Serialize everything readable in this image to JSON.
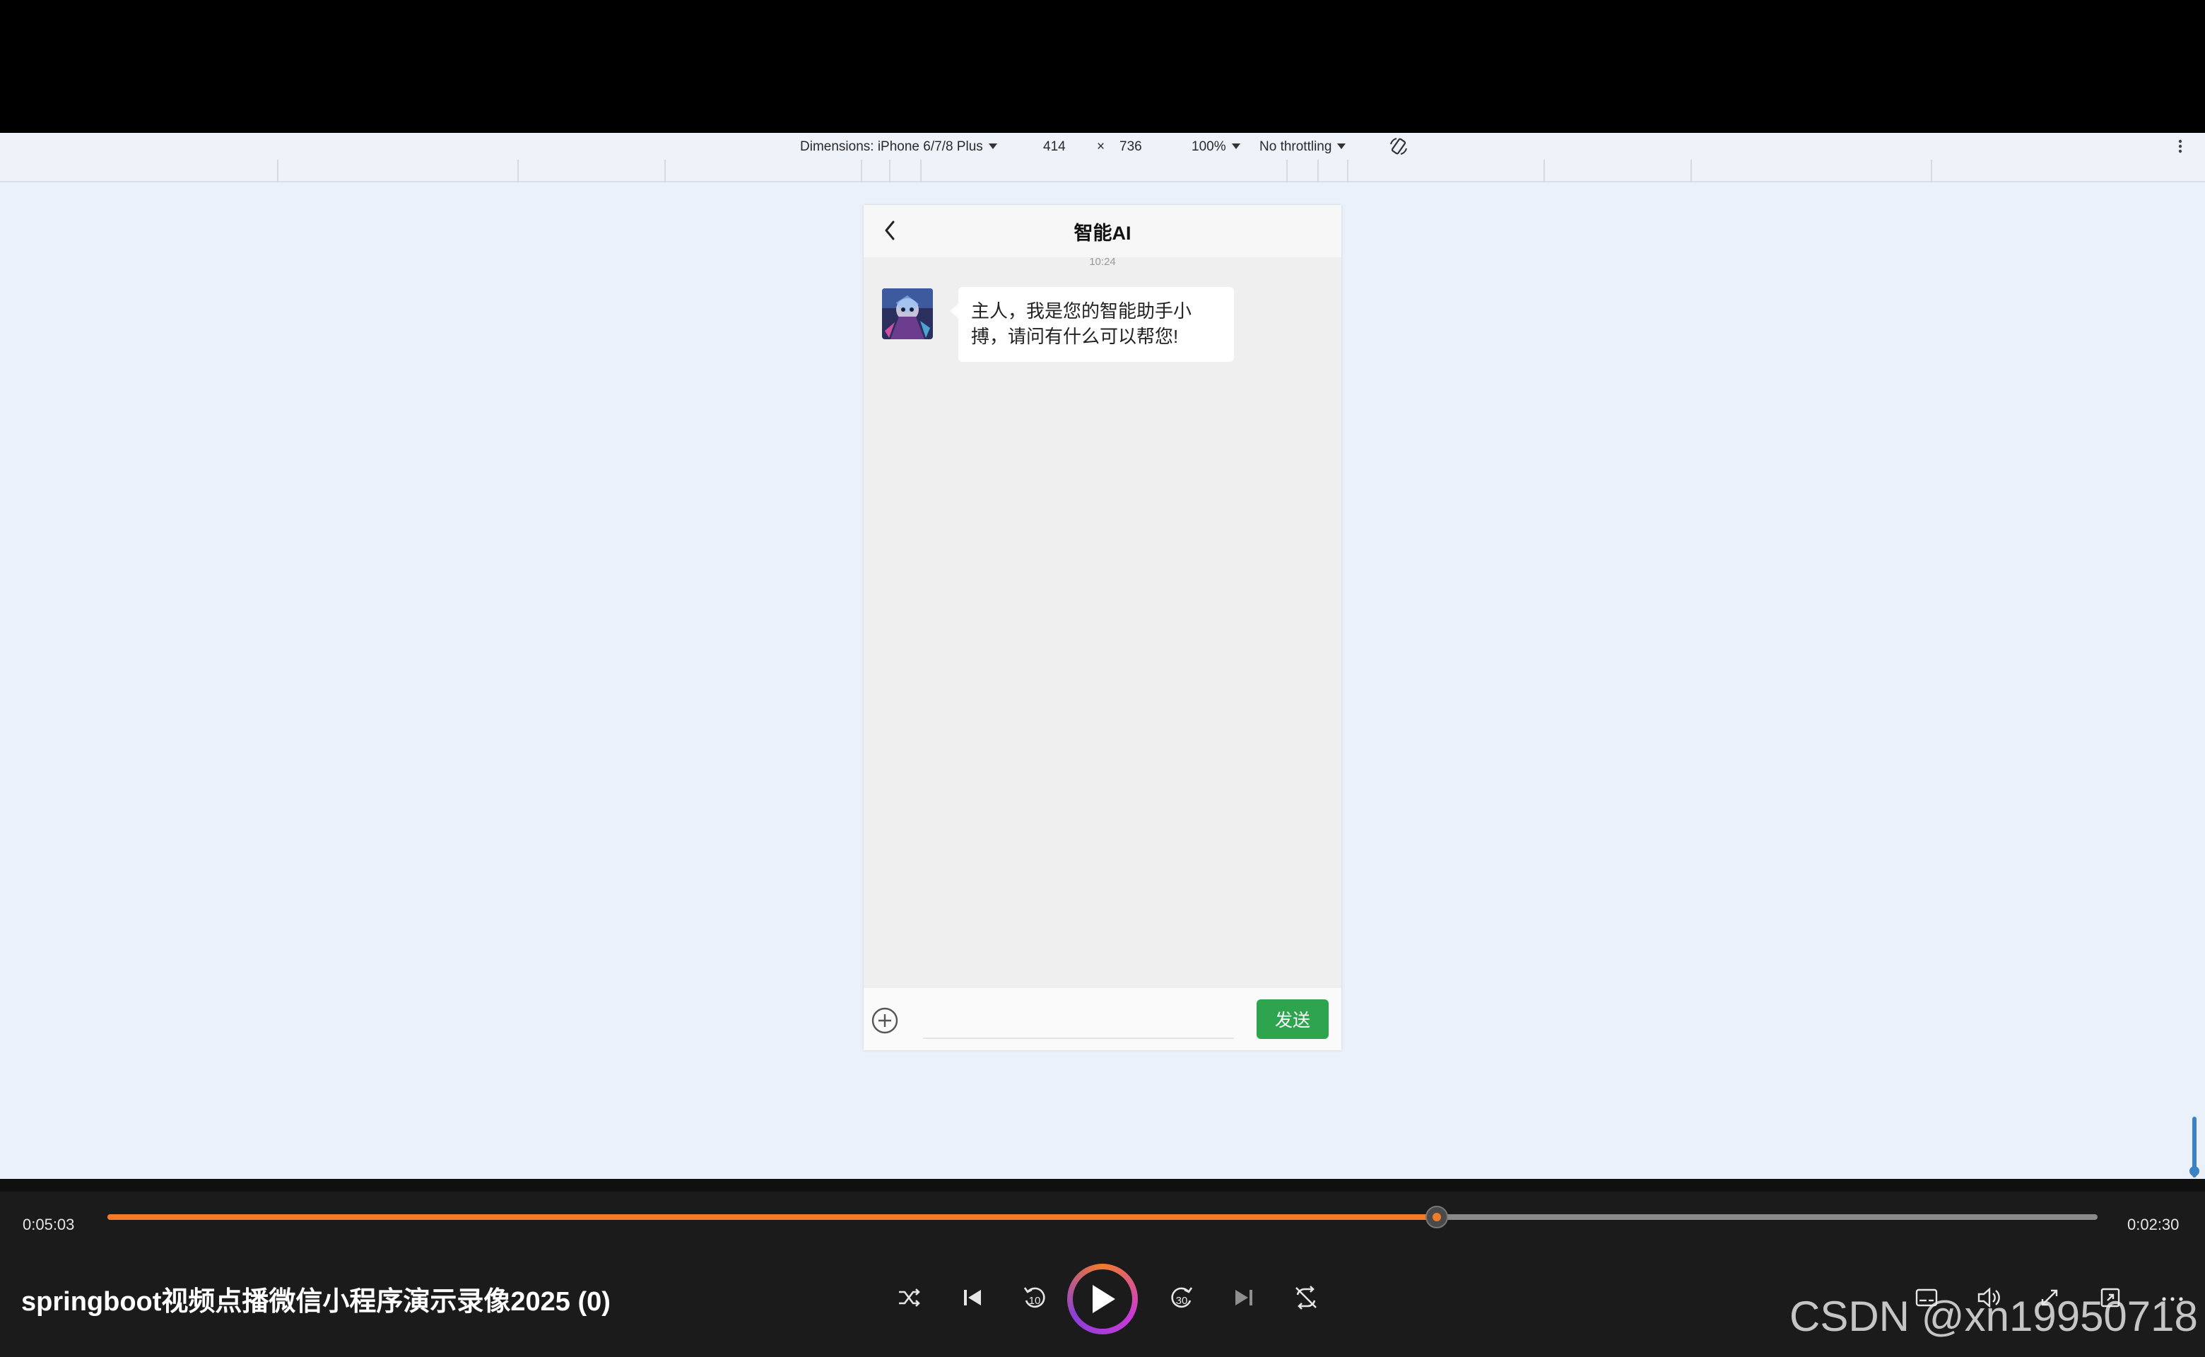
{
  "devtools": {
    "dimensions_label": "Dimensions: iPhone 6/7/8 Plus",
    "width_value": "414",
    "times_symbol": "×",
    "height_value": "736",
    "zoom_label": "100%",
    "throttling_label": "No throttling"
  },
  "app": {
    "nav_title": "智能AI",
    "timestamp": "10:24",
    "messages": [
      {
        "sender": "bot",
        "text": "主人，我是您的智能助手小搏，请问有什么可以帮您!"
      }
    ],
    "input": {
      "value": "",
      "placeholder": ""
    },
    "send_label": "发送"
  },
  "player": {
    "current_time": "0:05:03",
    "total_time": "0:02:30",
    "progress": 0.668,
    "title": "springboot视频点播微信小程序演示录像2025 (0)",
    "rewind_label": "10",
    "forward_label": "30"
  },
  "watermark": "CSDN @xn19950718",
  "colors": {
    "accent": "#f27b2a",
    "send_button": "#2ea44f",
    "viewport_bg": "#eaf1fb"
  },
  "icons": [
    "back-arrow-icon",
    "plus-circle-icon",
    "shuffle-icon",
    "previous-icon",
    "rewind-10-icon",
    "play-icon",
    "forward-30-icon",
    "next-icon",
    "repeat-off-icon",
    "subtitles-icon",
    "volume-icon",
    "fullscreen-icon",
    "mini-player-icon",
    "more-icon",
    "rotate-icon",
    "kebab-menu-icon"
  ]
}
